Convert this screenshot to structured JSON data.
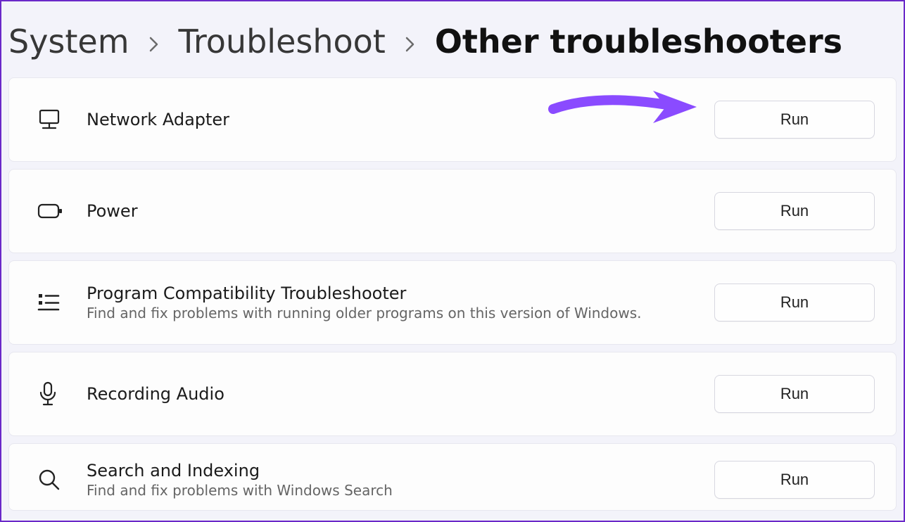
{
  "breadcrumb": {
    "items": [
      {
        "label": "System",
        "current": false
      },
      {
        "label": "Troubleshoot",
        "current": false
      },
      {
        "label": "Other troubleshooters",
        "current": true
      }
    ]
  },
  "buttons": {
    "run": "Run"
  },
  "annotation": {
    "arrow_color": "#8a4bff"
  },
  "troubleshooters": [
    {
      "id": "network-adapter",
      "icon": "network-adapter-icon",
      "title": "Network Adapter",
      "desc": "",
      "highlight_arrow": true
    },
    {
      "id": "power",
      "icon": "battery-icon",
      "title": "Power",
      "desc": ""
    },
    {
      "id": "program-compatibility",
      "icon": "list-icon",
      "title": "Program Compatibility Troubleshooter",
      "desc": "Find and fix problems with running older programs on this version of Windows."
    },
    {
      "id": "recording-audio",
      "icon": "microphone-icon",
      "title": "Recording Audio",
      "desc": ""
    },
    {
      "id": "search-indexing",
      "icon": "search-icon",
      "title": "Search and Indexing",
      "desc": "Find and fix problems with Windows Search"
    }
  ]
}
